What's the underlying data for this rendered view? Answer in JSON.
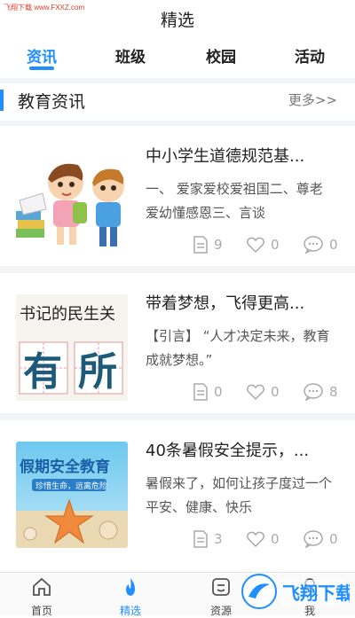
{
  "watermark_top": "飞翔下载  www.FXXZ.com",
  "page_title": "精选",
  "tabs": [
    {
      "label": "资讯",
      "active": true
    },
    {
      "label": "班级",
      "active": false
    },
    {
      "label": "校园",
      "active": false
    },
    {
      "label": "活动",
      "active": false
    }
  ],
  "section": {
    "title": "教育资讯",
    "more": "更多>>"
  },
  "articles": [
    {
      "title": "中小学生道德规范基...",
      "desc": "一、 爱家爱校爱祖国二、尊老爱幼懂感恩三、言谈",
      "views": "9",
      "likes": "0",
      "comments": "0",
      "thumb_icon": "kids-cartoon-image"
    },
    {
      "title": "带着梦想，飞得更高...",
      "desc": "【引言】      “人才决定未来，教育成就梦想。”",
      "views": "0",
      "likes": "0",
      "comments": "8",
      "thumb_icon": "calligraphy-image",
      "thumb_text_top": "书记的民生关",
      "thumb_char1": "有",
      "thumb_char2": "所"
    },
    {
      "title": "40条暑假安全提示，...",
      "desc": "暑假来了，如何让孩子度过一个平安、健康、快乐",
      "views": "3",
      "likes": "0",
      "comments": "0",
      "thumb_icon": "starfish-beach-image",
      "thumb_text_top": "假期安全教育",
      "thumb_text_sub": "珍惜生命，远离危险"
    }
  ],
  "tabbar": [
    {
      "label": "首页",
      "icon": "home-icon",
      "active": false
    },
    {
      "label": "精选",
      "icon": "flame-icon",
      "active": true
    },
    {
      "label": "资源",
      "icon": "resource-icon",
      "active": false
    },
    {
      "label": "我",
      "icon": "profile-icon",
      "active": false
    }
  ],
  "brand_watermark": "飞翔下载",
  "colors": {
    "accent": "#1f8fff",
    "watermark": "#e03a2a"
  }
}
